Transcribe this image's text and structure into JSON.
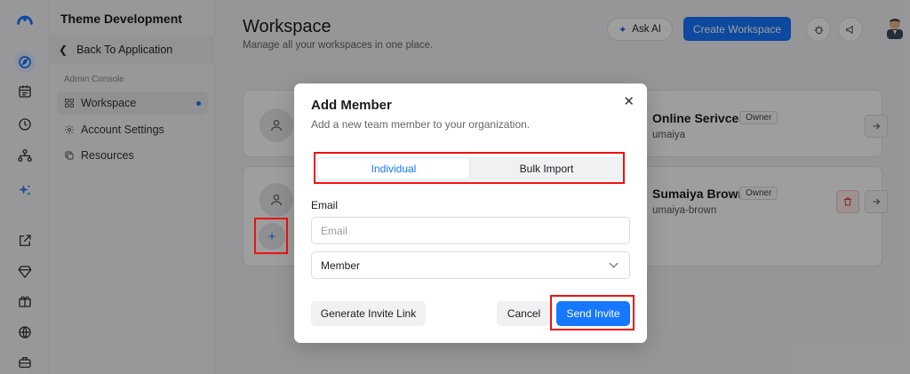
{
  "sidebar": {
    "title": "Theme Development",
    "back_label": "Back To Application",
    "section_label": "Admin Console",
    "items": [
      {
        "label": "Workspace"
      },
      {
        "label": "Account Settings"
      },
      {
        "label": "Resources"
      }
    ]
  },
  "header": {
    "title": "Workspace",
    "subtitle": "Manage all your workspaces in one place.",
    "ask_ai_label": "Ask AI",
    "create_label": "Create Workspace"
  },
  "workspaces": [
    {
      "name": "Online Serivces",
      "badge": "Owner",
      "slug": "umaiya"
    },
    {
      "name": "Sumaiya Brown",
      "badge": "Owner",
      "slug": "umaiya-brown"
    }
  ],
  "modal": {
    "title": "Add Member",
    "subtitle": "Add a new team member to your organization.",
    "close_glyph": "✕",
    "tabs": [
      {
        "label": "Individual"
      },
      {
        "label": "Bulk Import"
      }
    ],
    "email_label": "Email",
    "email_placeholder": "Email",
    "email_value": "",
    "role_value": "Member",
    "generate_label": "Generate Invite Link",
    "cancel_label": "Cancel",
    "send_label": "Send Invite"
  },
  "colors": {
    "accent": "#1677ff",
    "highlight": "#ee1111"
  }
}
